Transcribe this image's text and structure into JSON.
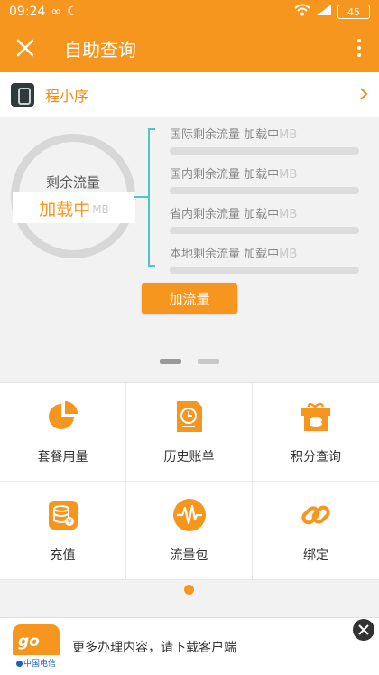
{
  "status_bar": {
    "time": "09:24",
    "battery": "45"
  },
  "header": {
    "close_icon": "close-icon",
    "title": "自助查询",
    "more_icon": "more-vertical-icon"
  },
  "mini_program": {
    "label": "程小序",
    "icon": "mini-program-icon"
  },
  "traffic": {
    "ring_label": "剩余流量",
    "ring_value": "加载中",
    "ring_unit": "MB",
    "rows": [
      {
        "name": "国际剩余流量",
        "value": "加载中",
        "unit": "MB",
        "progress": 0
      },
      {
        "name": "国内剩余流量",
        "value": "加载中",
        "unit": "MB",
        "progress": 0
      },
      {
        "name": "省内剩余流量",
        "value": "加载中",
        "unit": "MB",
        "progress": 0
      },
      {
        "name": "本地剩余流量",
        "value": "加载中",
        "unit": "MB",
        "progress": 0
      }
    ],
    "add_button": "加流量",
    "pager": {
      "pages": 2,
      "active": 1
    }
  },
  "menu": {
    "items": [
      {
        "label": "套餐用量",
        "icon": "pie-chart-icon"
      },
      {
        "label": "历史账单",
        "icon": "bill-clock-icon"
      },
      {
        "label": "积分查询",
        "icon": "gift-icon"
      },
      {
        "label": "充值",
        "icon": "coin-stack-icon"
      },
      {
        "label": "流量包",
        "icon": "waveform-icon"
      },
      {
        "label": "绑定",
        "icon": "link-icon"
      }
    ],
    "pager": {
      "pages": 1,
      "active": 1
    }
  },
  "banner": {
    "text": "更多办理内容，请下载客户端",
    "logo_text": "go",
    "logo_brand": "中国电信",
    "close_icon": "close-icon"
  },
  "colors": {
    "accent": "#f7961e",
    "bracket": "#4cc7c3"
  }
}
